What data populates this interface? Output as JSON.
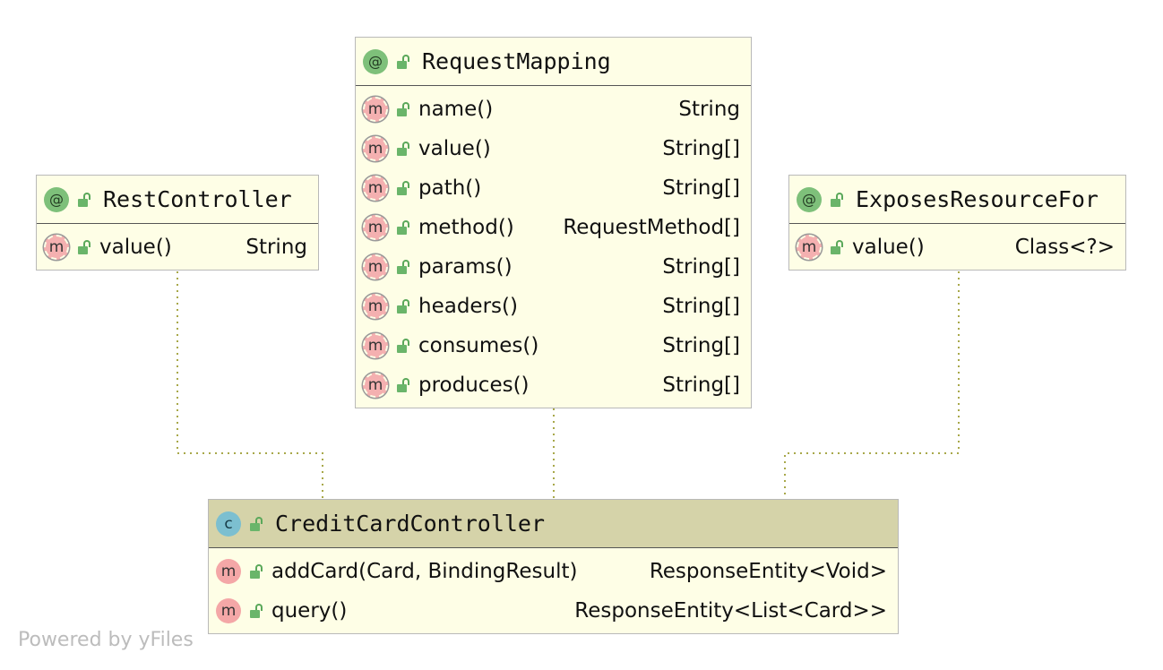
{
  "diagram": {
    "nodes": {
      "rest_controller": {
        "badge": "@",
        "title": "RestController",
        "members": [
          {
            "name": "value()",
            "type": "String"
          }
        ]
      },
      "request_mapping": {
        "badge": "@",
        "title": "RequestMapping",
        "members": [
          {
            "name": "name()",
            "type": "String"
          },
          {
            "name": "value()",
            "type": "String[]"
          },
          {
            "name": "path()",
            "type": "String[]"
          },
          {
            "name": "method()",
            "type": "RequestMethod[]"
          },
          {
            "name": "params()",
            "type": "String[]"
          },
          {
            "name": "headers()",
            "type": "String[]"
          },
          {
            "name": "consumes()",
            "type": "String[]"
          },
          {
            "name": "produces()",
            "type": "String[]"
          }
        ]
      },
      "exposes_resource_for": {
        "badge": "@",
        "title": "ExposesResourceFor",
        "members": [
          {
            "name": "value()",
            "type": "Class<?>"
          }
        ]
      },
      "credit_card_controller": {
        "badge": "c",
        "title": "CreditCardController",
        "members": [
          {
            "name": "addCard(Card, BindingResult)",
            "type": "ResponseEntity<Void>"
          },
          {
            "name": "query()",
            "type": "ResponseEntity<List<Card>>"
          }
        ]
      }
    },
    "edges": [
      {
        "from": "rest_controller",
        "to": "credit_card_controller",
        "style": "dotted"
      },
      {
        "from": "request_mapping",
        "to": "credit_card_controller",
        "style": "dotted"
      },
      {
        "from": "exposes_resource_for",
        "to": "credit_card_controller",
        "style": "dotted"
      }
    ],
    "method_badge_letter": "m",
    "colors": {
      "annotation_badge": "#7ec07a",
      "class_badge": "#7cbfd0",
      "method_badge": "#f4a7a7",
      "node_fill": "#fefee6",
      "class_header_fill": "#d5d3a9",
      "edge": "#a8a84a"
    }
  },
  "watermark": "Powered by yFiles"
}
